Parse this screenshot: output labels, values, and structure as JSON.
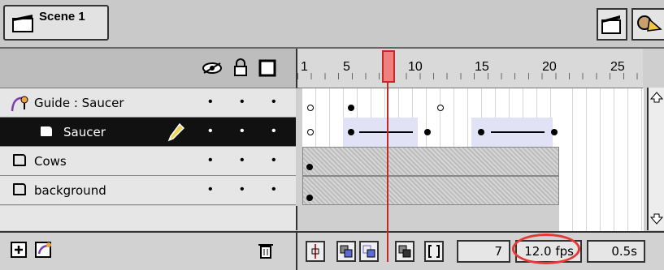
{
  "scene": {
    "title": "Scene 1"
  },
  "layers": [
    {
      "name": "Guide : Saucer",
      "type": "guide",
      "selected": false
    },
    {
      "name": "Saucer",
      "type": "normal",
      "selected": true
    },
    {
      "name": "Cows",
      "type": "normal",
      "selected": false
    },
    {
      "name": "background",
      "type": "normal",
      "selected": false
    }
  ],
  "header_icons": [
    "eye-icon",
    "lock-icon",
    "outline-square-icon"
  ],
  "ruler": {
    "labels": [
      "1",
      "5",
      "10",
      "15",
      "20",
      "25"
    ]
  },
  "status": {
    "current_frame": "7",
    "fps": "12.0 fps",
    "time": "0.5s"
  },
  "colors": {
    "playhead": "#f08080",
    "highlight": "#e53935"
  }
}
